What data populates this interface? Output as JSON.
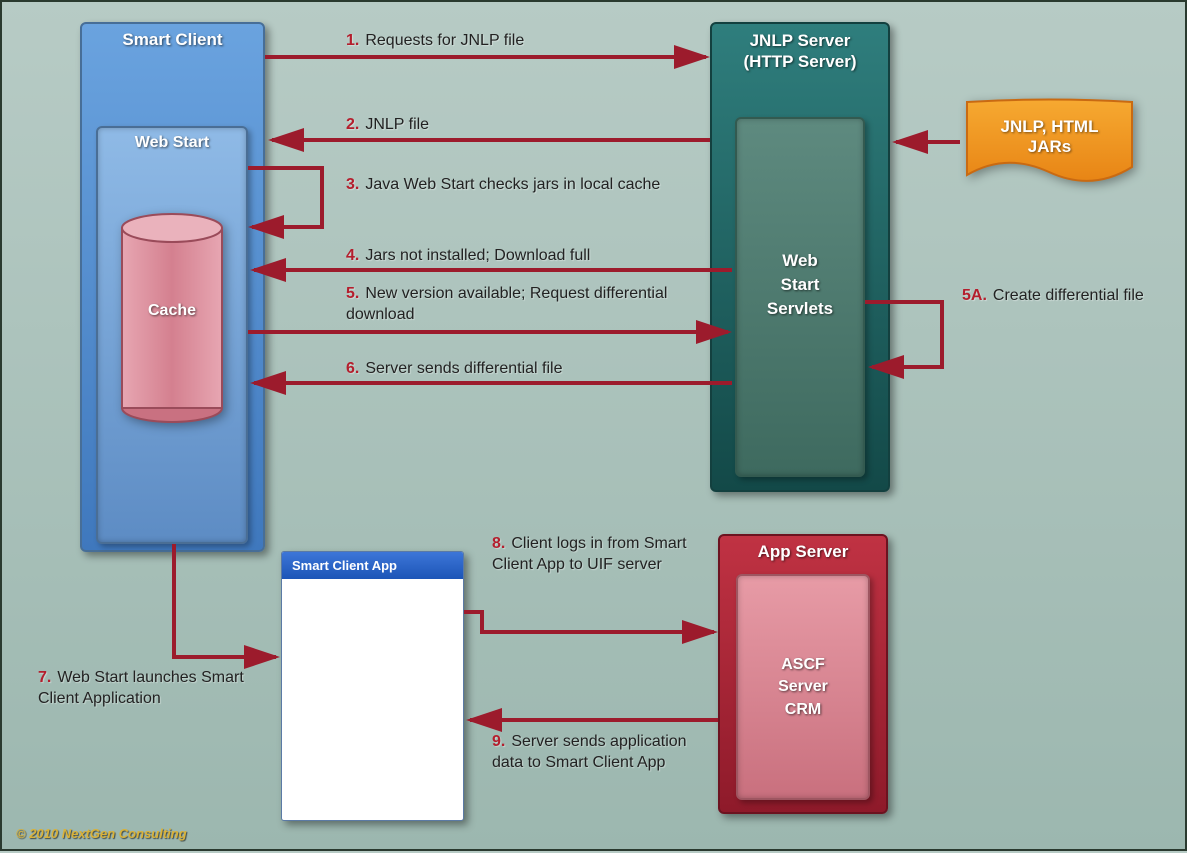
{
  "nodes": {
    "smart_client": "Smart Client",
    "web_start": "Web Start",
    "cache": "Cache",
    "jnlp_server_line1": "JNLP Server",
    "jnlp_server_line2": "(HTTP Server)",
    "servlets_line1": "Web",
    "servlets_line2": "Start",
    "servlets_line3": "Servlets",
    "jars_line1": "JNLP, HTML",
    "jars_line2": "JARs",
    "app_server": "App Server",
    "ascf_line1": "ASCF",
    "ascf_line2": "Server",
    "ascf_line3": "CRM",
    "app_window": "Smart Client App"
  },
  "steps": {
    "s1": {
      "num": "1.",
      "text": "Requests for JNLP file"
    },
    "s2": {
      "num": "2.",
      "text": "JNLP file"
    },
    "s3": {
      "num": "3.",
      "text": "Java Web Start checks jars in local cache"
    },
    "s4": {
      "num": "4.",
      "text": "Jars not installed; Download full"
    },
    "s5": {
      "num": "5.",
      "text": "New version available; Request differential download"
    },
    "s5a": {
      "num": "5A.",
      "text": "Create differential file"
    },
    "s6": {
      "num": "6.",
      "text": "Server sends differential file"
    },
    "s7": {
      "num": "7.",
      "text": "Web Start launches Smart Client Application"
    },
    "s8": {
      "num": "8.",
      "text": "Client logs in from Smart Client App to UIF server"
    },
    "s9": {
      "num": "9.",
      "text": "Server sends application data to Smart Client App"
    }
  },
  "copyright": "© 2010 NextGen Consulting"
}
